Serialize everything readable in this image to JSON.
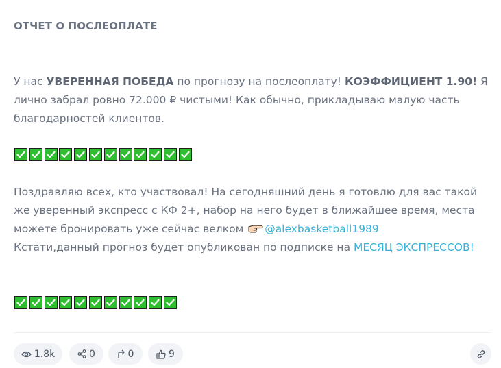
{
  "post": {
    "title": "ОТЧЕТ О ПОСЛЕОПЛАТЕ",
    "p1": {
      "t1": "У нас ",
      "b1": "УВЕРЕННАЯ ПОБЕДА",
      "t2": " по прогнозу на послеоплату! ",
      "b2": "КОЭФФИЦИЕНТ 1.90!",
      "t3": " Я лично забрал ровно 72.000 ₽ чистыми! Как обычно, прикладываю малую часть благодарностей клиентов."
    },
    "p2": {
      "t1": "Поздравляю всех, кто участвовал! На сегодняшний день я готовлю для вас такой же уверенный экспресс с КФ 2+, набор на него будет в ближайшее время, места можете бронировать уже сейчас велком ",
      "mention": "@alexbasketball1989",
      "t2": "Кстати,данный прогноз будет опубликован по подписке на ",
      "link": "МЕСЯЦ ЭКСПРЕССОВ!"
    },
    "checks_row1_count": 12,
    "checks_row2_count": 11,
    "check_emoji": "white-heavy-check-mark-icon",
    "hand_emoji": "pointing-right-hand-icon"
  },
  "footer": {
    "views": "1.8k",
    "shares": "0",
    "reposts": "0",
    "likes": "9"
  },
  "colors": {
    "text": "#6b7280",
    "link": "#38b2d8",
    "check_green": "#2fbe30",
    "pill_bg": "#f1f3f6"
  }
}
